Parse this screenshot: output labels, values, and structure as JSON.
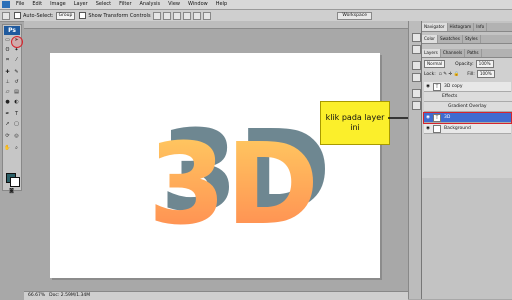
{
  "menubar": {
    "items": [
      "File",
      "Edit",
      "Image",
      "Layer",
      "Select",
      "Filter",
      "Analysis",
      "View",
      "Window",
      "Help"
    ]
  },
  "options": {
    "auto_select_label": "Auto-Select:",
    "auto_select_value": "Group",
    "show_transform_label": "Show Transform Controls",
    "workspace_label": "Workspace"
  },
  "toolbox": {
    "logo_text": "Ps"
  },
  "document": {
    "title": "",
    "art_text": "3D",
    "art_colors": {
      "top": "#ffd062",
      "bottom": "#ff8550",
      "shadow": "#6e8791"
    }
  },
  "callout": {
    "text_line1": "klik pada layer",
    "text_line2": "ini"
  },
  "status": {
    "zoom": "66.67%",
    "doc_info": "Doc: 2.59M/1.34M"
  },
  "panels": {
    "group1_tabs": [
      "Navigator",
      "Histogram",
      "Info"
    ],
    "group2_tabs": [
      "Color",
      "Swatches",
      "Styles"
    ],
    "layers_tabs": [
      "Layers",
      "Channels",
      "Paths"
    ],
    "blend_mode": "Normal",
    "opacity_label": "Opacity:",
    "opacity_value": "100%",
    "lock_label": "Lock:",
    "fill_label": "Fill:",
    "fill_value": "100%"
  },
  "layers": [
    {
      "name": "3D copy",
      "type": "T"
    },
    {
      "name": "Effects",
      "type": ""
    },
    {
      "name": "Gradient Overlay",
      "type": ""
    },
    {
      "name": "3D",
      "type": "T",
      "selected": true
    },
    {
      "name": "Background",
      "type": ""
    }
  ],
  "colors": {
    "callout_bg": "#fbef2b",
    "highlight_red": "#d6242c",
    "selected_layer": "#3f6bd0"
  }
}
